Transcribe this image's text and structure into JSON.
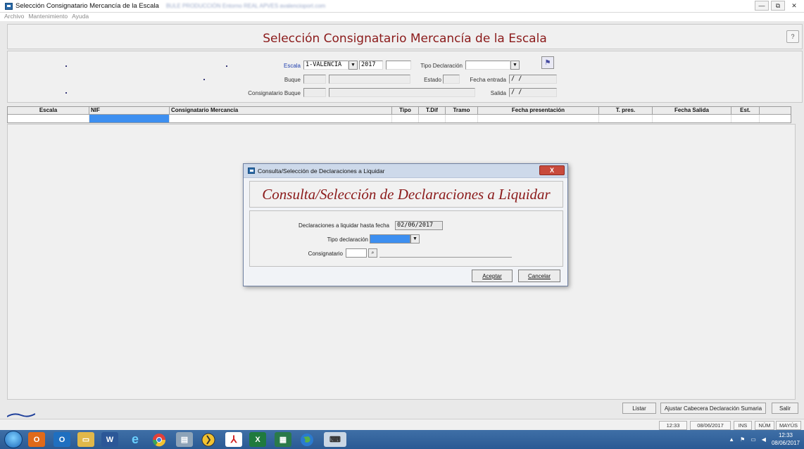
{
  "window": {
    "title": "Selección Consignatario Mercancía de la Escala",
    "title_extra": "BULE PRODUCCIÓN Entorno REAL APVES avalencioport.com",
    "minimize": "—",
    "restore": "⧉",
    "close": "✕"
  },
  "menu": [
    "Archivo",
    "Mantenimiento",
    "Ayuda"
  ],
  "header": {
    "title": "Selección Consignatario Mercancía de la Escala",
    "help_icon": "?"
  },
  "filters": {
    "escala_label": "Escala",
    "escala_value": "1-VALENCIA",
    "year_value": "2017",
    "escala_extra_value": "",
    "tipo_declaracion_label": "Tipo Declaración",
    "tipo_declaracion_value": "",
    "buque_label": "Buque",
    "buque_code": "",
    "buque_name": "",
    "estado_label": "Estado",
    "estado_value": "",
    "fecha_entrada_label": "Fecha entrada",
    "fecha_entrada_value": "/   /",
    "consignatario_buque_label": "Consignatario Buque",
    "consignatario_buque_code": "",
    "consignatario_buque_name": "",
    "salida_label": "Salida",
    "salida_value": "/   /"
  },
  "grid": {
    "columns": [
      "Escala",
      "NIF",
      "Consignatario Mercancía",
      "Tipo",
      "T.Dif",
      "Tramo",
      "Fecha presentación",
      "T. pres.",
      "Fecha Salida",
      "Est."
    ]
  },
  "dialog": {
    "window_title": "Consulta/Selección de Declaraciones a Liquidar",
    "close": "X",
    "header": "Consulta/Selección de Declaraciones a Liquidar",
    "fecha_label": "Declaraciones a liquidar hasta fecha",
    "fecha_value": "02/06/2017",
    "tipo_label": "Tipo declaración",
    "tipo_value": "",
    "consignatario_label": "Consignatario",
    "consignatario_code": "",
    "consignatario_name": "",
    "aceptar": "Aceptar",
    "cancelar": "Cancelar"
  },
  "actions": {
    "listar": "Listar",
    "ajustar": "Ajustar Cabecera Declaración Sumaria",
    "salir": "Salir"
  },
  "statusbar": {
    "time": "12:33",
    "date": "08/06/2017",
    "ins": "INS",
    "num": "NÚM",
    "mayus": "MAYÚS"
  },
  "taskbar": {
    "clock_time": "12:33",
    "clock_date": "08/06/2017",
    "apps": [
      "outlook-icon",
      "office-icon",
      "outlook-2-icon",
      "explorer-icon",
      "word-icon",
      "ie-icon",
      "chrome-icon",
      "notepad-icon",
      "app-icon",
      "acrobat-icon",
      "excel-icon",
      "calc-icon",
      "globe-icon",
      "tool-icon"
    ]
  },
  "colors": {
    "title_red": "#8b1a1a",
    "selection_blue": "#3d8ff0",
    "taskbar": "#2f5f9a"
  }
}
